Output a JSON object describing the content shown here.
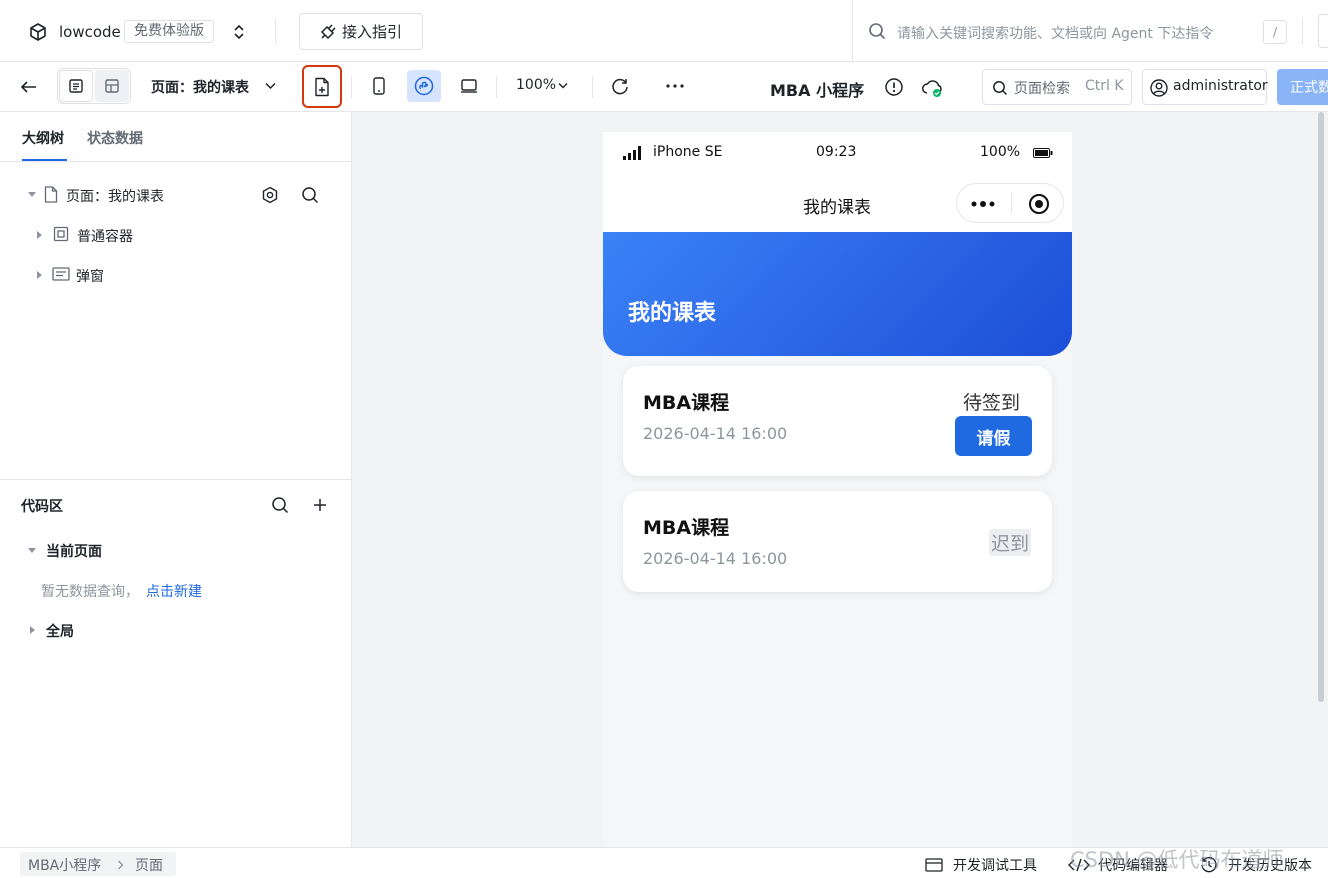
{
  "topbar": {
    "app_name": "lowcode",
    "edition_badge": "免费体验版",
    "guide_button": "接入指引",
    "search_placeholder": "请输入关键词搜索功能、文档或向 Agent 下达指令",
    "search_shortcut": "/"
  },
  "toolbar": {
    "page_selector": "页面：我的课表",
    "zoom": "100%",
    "app_title": "MBA 小程序",
    "page_search_label": "页面检索",
    "page_search_shortcut": "Ctrl K",
    "user": "administrator",
    "publish_label": "正式数"
  },
  "left": {
    "tabs": [
      "大纲树",
      "状态数据"
    ],
    "active_tab": 0,
    "tree_root": "页面：我的课表",
    "tree_items": [
      "普通容器",
      "弹窗"
    ],
    "code_title": "代码区",
    "current_page": "当前页面",
    "no_data_text": "暂无数据查询，",
    "create_link": "点击新建",
    "global": "全局"
  },
  "phone": {
    "carrier": "iPhone SE",
    "time": "09:23",
    "battery": "100%",
    "nav_title": "我的课表",
    "header_title": "我的课表",
    "header_gradient": [
      "#3b82f6",
      "#1d4ed8"
    ],
    "cards": [
      {
        "title": "MBA课程",
        "datetime": "2026-04-14 16:00",
        "status": "待签到",
        "button": "请假"
      },
      {
        "title": "MBA课程",
        "datetime": "2026-04-14 16:00",
        "status": "迟到"
      }
    ]
  },
  "statusbar": {
    "breadcrumb": [
      "MBA小程序",
      "页面"
    ],
    "debug_tools": "开发调试工具",
    "code_editor": "代码编辑器",
    "history": "开发历史版本",
    "watermark": "CSDN @低代码布道师"
  },
  "colors": {
    "accent": "#1f6ae0",
    "highlight_border": "#d4380d",
    "publish_bg": "#8ab4f8"
  }
}
